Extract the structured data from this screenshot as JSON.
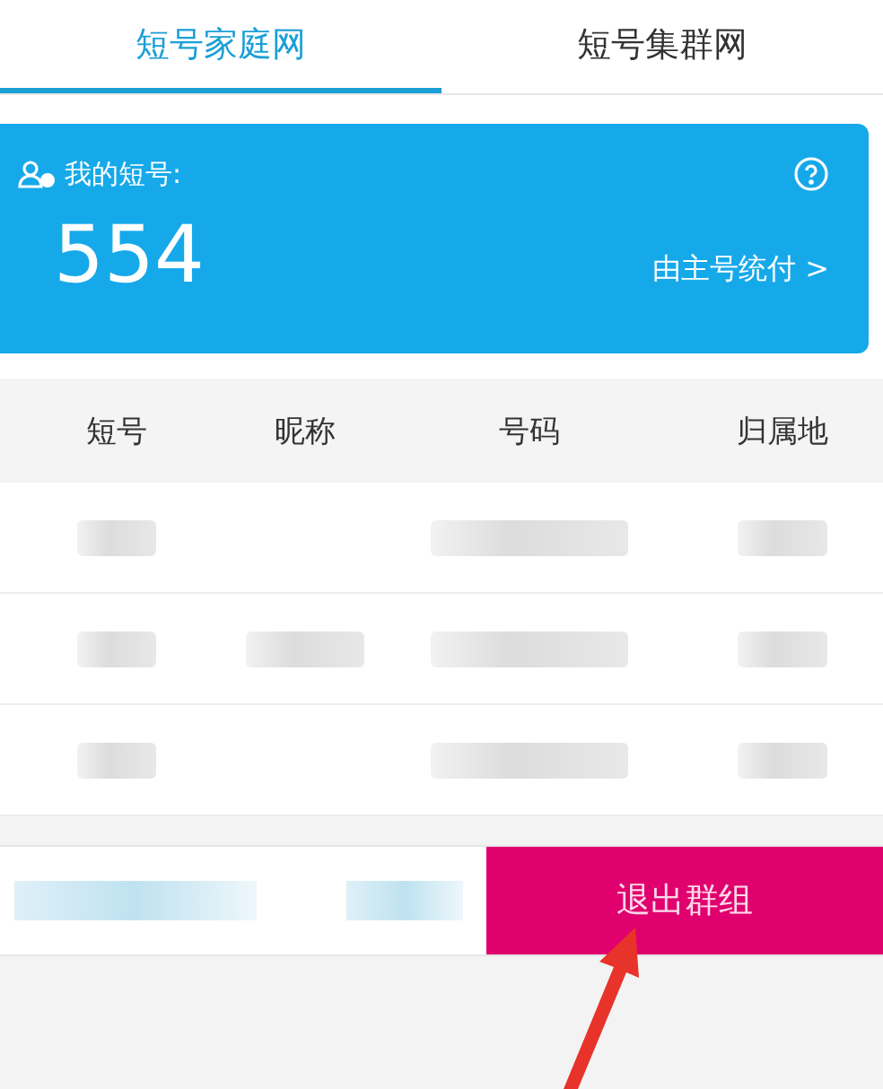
{
  "tabs": [
    {
      "label": "短号家庭网",
      "selected": true
    },
    {
      "label": "短号集群网",
      "selected": false
    }
  ],
  "card": {
    "title": "我的短号:",
    "short_number": "554",
    "payment_link": "由主号统付 >"
  },
  "table": {
    "columns": [
      "短号",
      "昵称",
      "号码",
      "归属地"
    ],
    "blurred_rows": [
      {
        "has_nickname": false
      },
      {
        "has_nickname": true
      },
      {
        "has_nickname": false
      }
    ]
  },
  "footer": {
    "button": "退出群组"
  }
}
